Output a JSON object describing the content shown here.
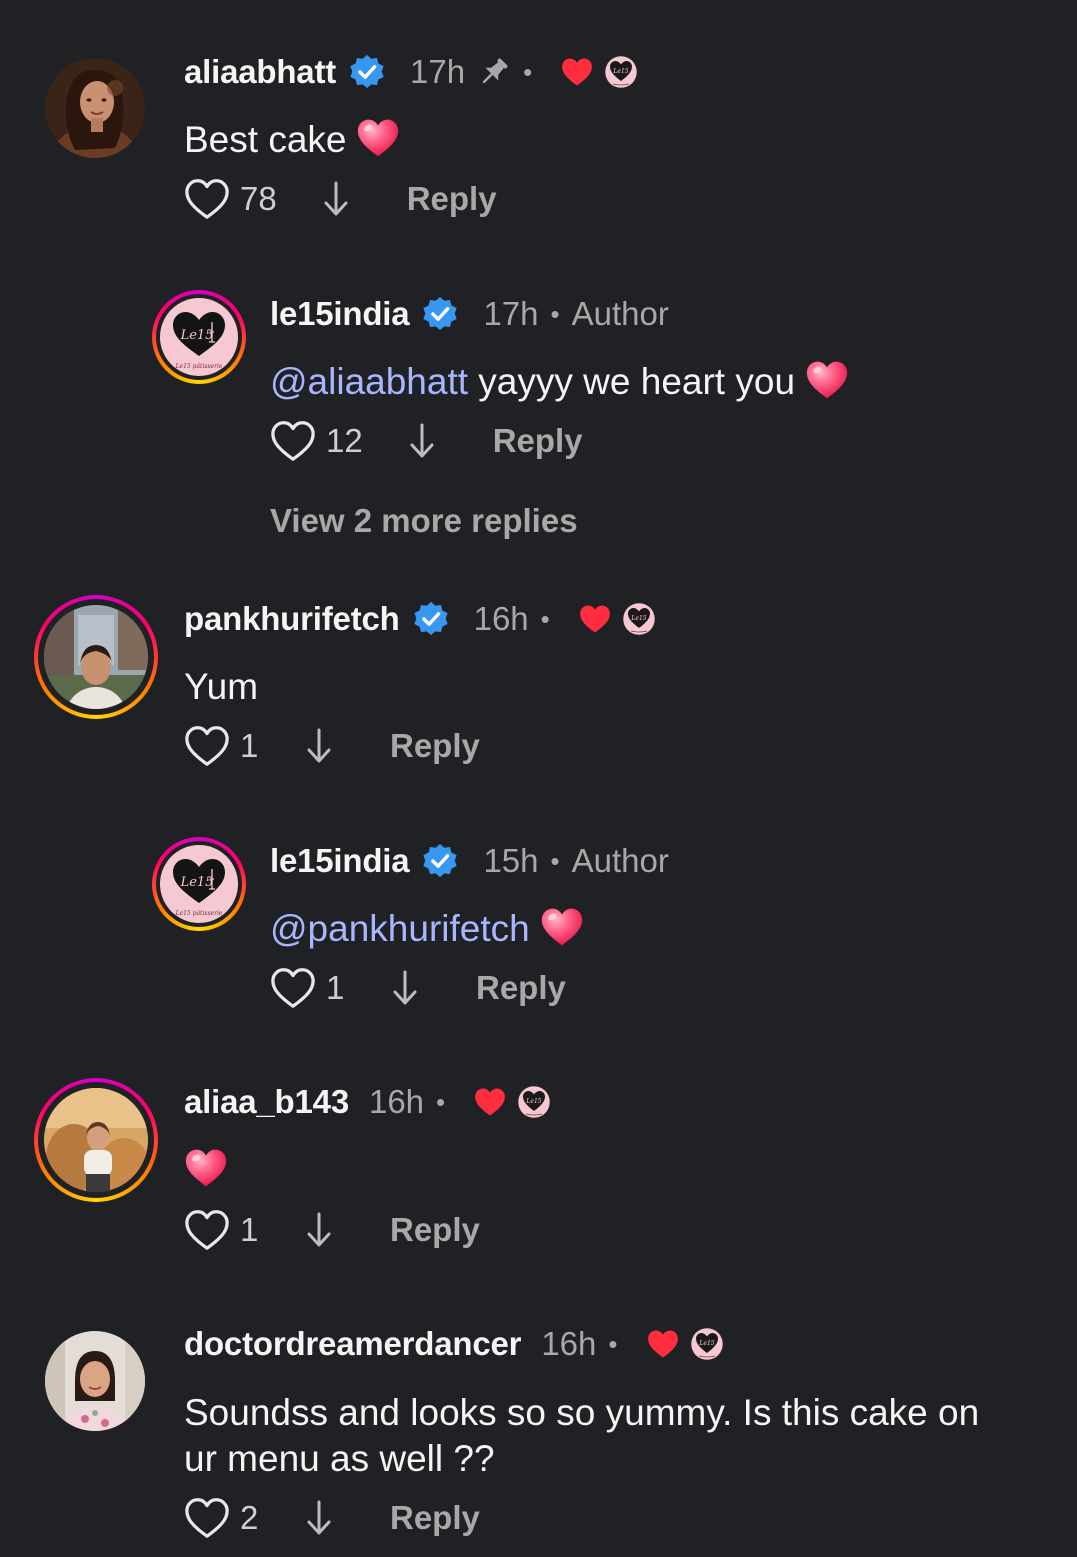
{
  "comments": [
    {
      "username": "aliaabhatt",
      "time": "17h",
      "text": "Best cake",
      "likes": "78",
      "reply": "Reply"
    },
    {
      "username": "le15india",
      "time": "17h",
      "author": "Author",
      "mention": "@aliaabhatt",
      "text": " yayyy we heart you",
      "likes": "12",
      "reply": "Reply",
      "view_more": "View 2 more replies"
    },
    {
      "username": "pankhurifetch",
      "time": "16h",
      "text": "Yum",
      "likes": "1",
      "reply": "Reply"
    },
    {
      "username": "le15india",
      "time": "15h",
      "author": "Author",
      "mention": "@pankhurifetch",
      "likes": "1",
      "reply": "Reply"
    },
    {
      "username": "aliaa_b143",
      "time": "16h",
      "likes": "1",
      "reply": "Reply"
    },
    {
      "username": "doctordreamerdancer",
      "time": "16h",
      "text_line1": "Soundss and looks so so yummy. Is this cake on",
      "text_line2": "ur menu as well ??",
      "likes": "2",
      "reply": "Reply"
    }
  ],
  "logo_text": "Le15",
  "logo_sub": "Le15 pâtisserie",
  "dot": "•",
  "colors": {
    "background": "#202124",
    "verified": "#3897f0",
    "mention": "#a9b6ff",
    "heart_red": "#ff2d3d",
    "logo_pink": "#f6c9d2"
  }
}
